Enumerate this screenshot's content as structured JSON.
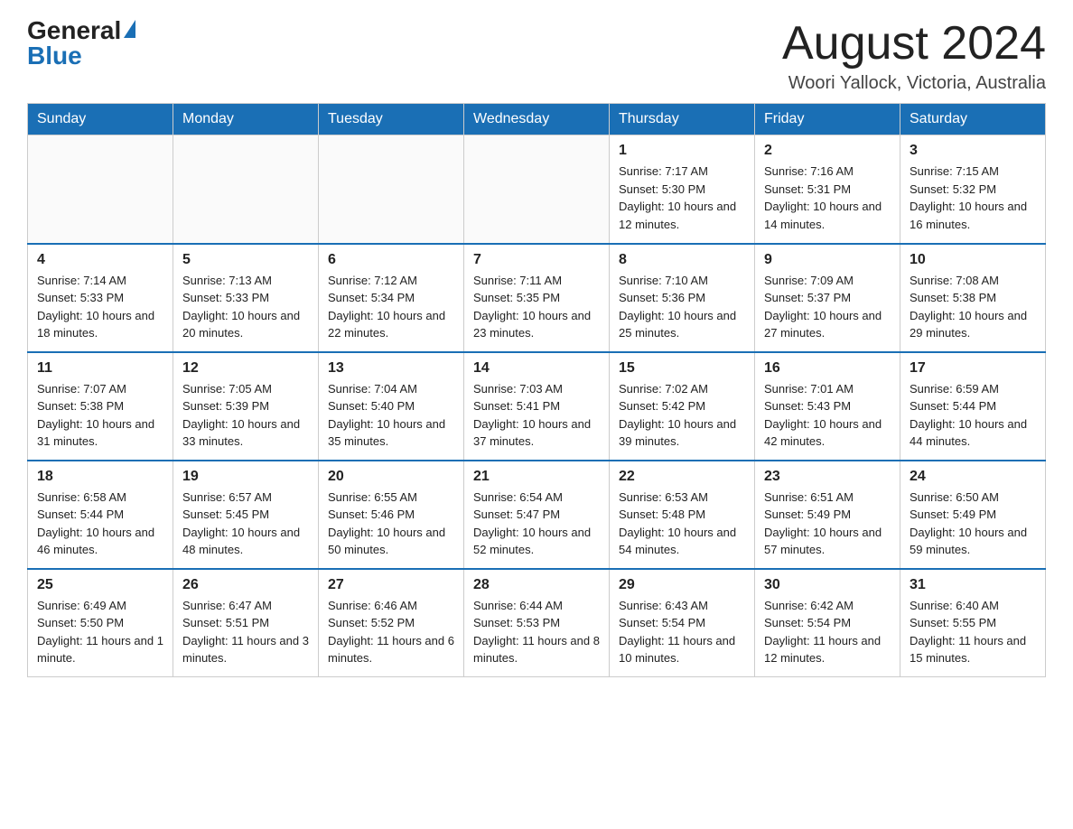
{
  "logo": {
    "general": "General",
    "blue": "Blue"
  },
  "header": {
    "month_year": "August 2024",
    "location": "Woori Yallock, Victoria, Australia"
  },
  "weekdays": [
    "Sunday",
    "Monday",
    "Tuesday",
    "Wednesday",
    "Thursday",
    "Friday",
    "Saturday"
  ],
  "weeks": [
    [
      {
        "day": "",
        "info": ""
      },
      {
        "day": "",
        "info": ""
      },
      {
        "day": "",
        "info": ""
      },
      {
        "day": "",
        "info": ""
      },
      {
        "day": "1",
        "info": "Sunrise: 7:17 AM\nSunset: 5:30 PM\nDaylight: 10 hours and 12 minutes."
      },
      {
        "day": "2",
        "info": "Sunrise: 7:16 AM\nSunset: 5:31 PM\nDaylight: 10 hours and 14 minutes."
      },
      {
        "day": "3",
        "info": "Sunrise: 7:15 AM\nSunset: 5:32 PM\nDaylight: 10 hours and 16 minutes."
      }
    ],
    [
      {
        "day": "4",
        "info": "Sunrise: 7:14 AM\nSunset: 5:33 PM\nDaylight: 10 hours and 18 minutes."
      },
      {
        "day": "5",
        "info": "Sunrise: 7:13 AM\nSunset: 5:33 PM\nDaylight: 10 hours and 20 minutes."
      },
      {
        "day": "6",
        "info": "Sunrise: 7:12 AM\nSunset: 5:34 PM\nDaylight: 10 hours and 22 minutes."
      },
      {
        "day": "7",
        "info": "Sunrise: 7:11 AM\nSunset: 5:35 PM\nDaylight: 10 hours and 23 minutes."
      },
      {
        "day": "8",
        "info": "Sunrise: 7:10 AM\nSunset: 5:36 PM\nDaylight: 10 hours and 25 minutes."
      },
      {
        "day": "9",
        "info": "Sunrise: 7:09 AM\nSunset: 5:37 PM\nDaylight: 10 hours and 27 minutes."
      },
      {
        "day": "10",
        "info": "Sunrise: 7:08 AM\nSunset: 5:38 PM\nDaylight: 10 hours and 29 minutes."
      }
    ],
    [
      {
        "day": "11",
        "info": "Sunrise: 7:07 AM\nSunset: 5:38 PM\nDaylight: 10 hours and 31 minutes."
      },
      {
        "day": "12",
        "info": "Sunrise: 7:05 AM\nSunset: 5:39 PM\nDaylight: 10 hours and 33 minutes."
      },
      {
        "day": "13",
        "info": "Sunrise: 7:04 AM\nSunset: 5:40 PM\nDaylight: 10 hours and 35 minutes."
      },
      {
        "day": "14",
        "info": "Sunrise: 7:03 AM\nSunset: 5:41 PM\nDaylight: 10 hours and 37 minutes."
      },
      {
        "day": "15",
        "info": "Sunrise: 7:02 AM\nSunset: 5:42 PM\nDaylight: 10 hours and 39 minutes."
      },
      {
        "day": "16",
        "info": "Sunrise: 7:01 AM\nSunset: 5:43 PM\nDaylight: 10 hours and 42 minutes."
      },
      {
        "day": "17",
        "info": "Sunrise: 6:59 AM\nSunset: 5:44 PM\nDaylight: 10 hours and 44 minutes."
      }
    ],
    [
      {
        "day": "18",
        "info": "Sunrise: 6:58 AM\nSunset: 5:44 PM\nDaylight: 10 hours and 46 minutes."
      },
      {
        "day": "19",
        "info": "Sunrise: 6:57 AM\nSunset: 5:45 PM\nDaylight: 10 hours and 48 minutes."
      },
      {
        "day": "20",
        "info": "Sunrise: 6:55 AM\nSunset: 5:46 PM\nDaylight: 10 hours and 50 minutes."
      },
      {
        "day": "21",
        "info": "Sunrise: 6:54 AM\nSunset: 5:47 PM\nDaylight: 10 hours and 52 minutes."
      },
      {
        "day": "22",
        "info": "Sunrise: 6:53 AM\nSunset: 5:48 PM\nDaylight: 10 hours and 54 minutes."
      },
      {
        "day": "23",
        "info": "Sunrise: 6:51 AM\nSunset: 5:49 PM\nDaylight: 10 hours and 57 minutes."
      },
      {
        "day": "24",
        "info": "Sunrise: 6:50 AM\nSunset: 5:49 PM\nDaylight: 10 hours and 59 minutes."
      }
    ],
    [
      {
        "day": "25",
        "info": "Sunrise: 6:49 AM\nSunset: 5:50 PM\nDaylight: 11 hours and 1 minute."
      },
      {
        "day": "26",
        "info": "Sunrise: 6:47 AM\nSunset: 5:51 PM\nDaylight: 11 hours and 3 minutes."
      },
      {
        "day": "27",
        "info": "Sunrise: 6:46 AM\nSunset: 5:52 PM\nDaylight: 11 hours and 6 minutes."
      },
      {
        "day": "28",
        "info": "Sunrise: 6:44 AM\nSunset: 5:53 PM\nDaylight: 11 hours and 8 minutes."
      },
      {
        "day": "29",
        "info": "Sunrise: 6:43 AM\nSunset: 5:54 PM\nDaylight: 11 hours and 10 minutes."
      },
      {
        "day": "30",
        "info": "Sunrise: 6:42 AM\nSunset: 5:54 PM\nDaylight: 11 hours and 12 minutes."
      },
      {
        "day": "31",
        "info": "Sunrise: 6:40 AM\nSunset: 5:55 PM\nDaylight: 11 hours and 15 minutes."
      }
    ]
  ]
}
